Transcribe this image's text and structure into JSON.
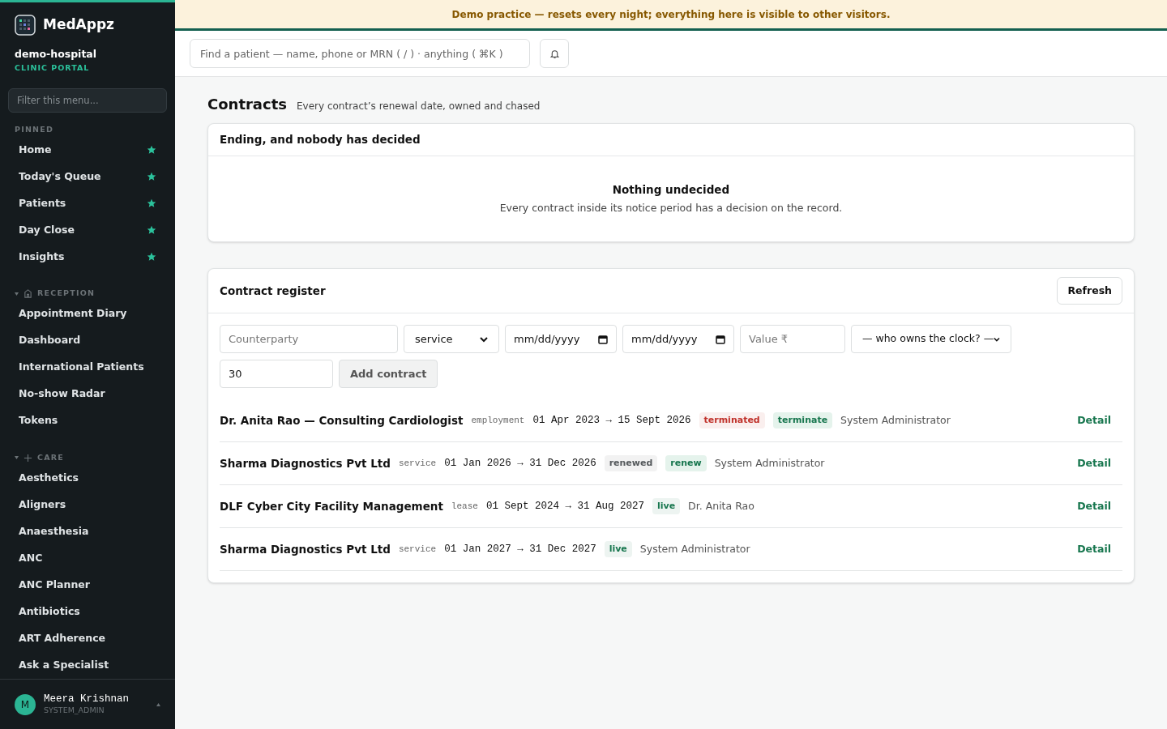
{
  "brand": {
    "name": "MedAppz",
    "org": "demo-hospital",
    "portal": "CLINIC PORTAL"
  },
  "sidebar": {
    "filter_placeholder": "Filter this menu...",
    "sections": [
      {
        "title": "PINNED",
        "items": [
          {
            "label": "Home",
            "pinned": true
          },
          {
            "label": "Today's Queue",
            "pinned": true
          },
          {
            "label": "Patients",
            "pinned": true
          },
          {
            "label": "Day Close",
            "pinned": true
          },
          {
            "label": "Insights",
            "pinned": true
          }
        ]
      },
      {
        "title": "RECEPTION",
        "kind": "reception",
        "expanded": true,
        "items": [
          {
            "label": "Appointment Diary",
            "pinned": false
          },
          {
            "label": "Dashboard",
            "pinned": false
          },
          {
            "label": "International Patients",
            "pinned": false
          },
          {
            "label": "No-show Radar",
            "pinned": false
          },
          {
            "label": "Tokens",
            "pinned": false
          }
        ]
      },
      {
        "title": "CARE",
        "kind": "care",
        "expanded": true,
        "items": [
          {
            "label": "Aesthetics",
            "pinned": false
          },
          {
            "label": "Aligners",
            "pinned": false
          },
          {
            "label": "Anaesthesia",
            "pinned": false
          },
          {
            "label": "ANC",
            "pinned": false
          },
          {
            "label": "ANC Planner",
            "pinned": false
          },
          {
            "label": "Antibiotics",
            "pinned": false
          },
          {
            "label": "ART Adherence",
            "pinned": false
          },
          {
            "label": "Ask a Specialist",
            "pinned": false
          }
        ]
      }
    ]
  },
  "user": {
    "initial": "M",
    "name": "Meera Krishnan",
    "role": "SYSTEM_ADMIN"
  },
  "banner": "Demo practice — resets every night; everything here is visible to other visitors.",
  "search": {
    "placeholder": "Find a patient — name, phone or MRN ( / ) · anything ( ⌘K )"
  },
  "page": {
    "title": "Contracts",
    "subtitle": "Every contract’s renewal date, owned and chased"
  },
  "undecided": {
    "title": "Ending, and nobody has decided",
    "empty_title": "Nothing undecided",
    "empty_text": "Every contract inside its notice period has a decision on the record."
  },
  "register": {
    "title": "Contract register",
    "refresh": "Refresh",
    "form": {
      "counterparty_placeholder": "Counterparty",
      "type_value": "service",
      "start_value": "mm/dd/yyyy",
      "end_value": "mm/dd/yyyy",
      "value_placeholder": "Value ₹",
      "owner_value": "— who owns the clock? —",
      "notice_value": "30",
      "submit": "Add contract"
    },
    "rows": [
      {
        "name": "Dr. Anita Rao — Consulting Cardiologist",
        "type": "employment",
        "dates": "01 Apr 2023 → 15 Sept 2026",
        "status": {
          "text": "terminated",
          "color": "#c0322b"
        },
        "decision": "terminate",
        "owner": "System Administrator",
        "action": "Detail"
      },
      {
        "name": "Sharma Diagnostics Pvt Ltd",
        "type": "service",
        "dates": "01 Jan 2026 → 31 Dec 2026",
        "status": {
          "text": "renewed",
          "color": "#55595c"
        },
        "decision": "renew",
        "owner": "System Administrator",
        "action": "Detail"
      },
      {
        "name": "DLF Cyber City Facility Management",
        "type": "lease",
        "dates": "01 Sept 2024 → 31 Aug 2027",
        "status": {
          "text": "live",
          "color": "#17764e"
        },
        "owner": "Dr. Anita Rao",
        "action": "Detail"
      },
      {
        "name": "Sharma Diagnostics Pvt Ltd",
        "type": "service",
        "dates": "01 Jan 2027 → 31 Dec 2027",
        "status": {
          "text": "live",
          "color": "#17764e"
        },
        "owner": "System Administrator",
        "action": "Detail"
      }
    ]
  }
}
